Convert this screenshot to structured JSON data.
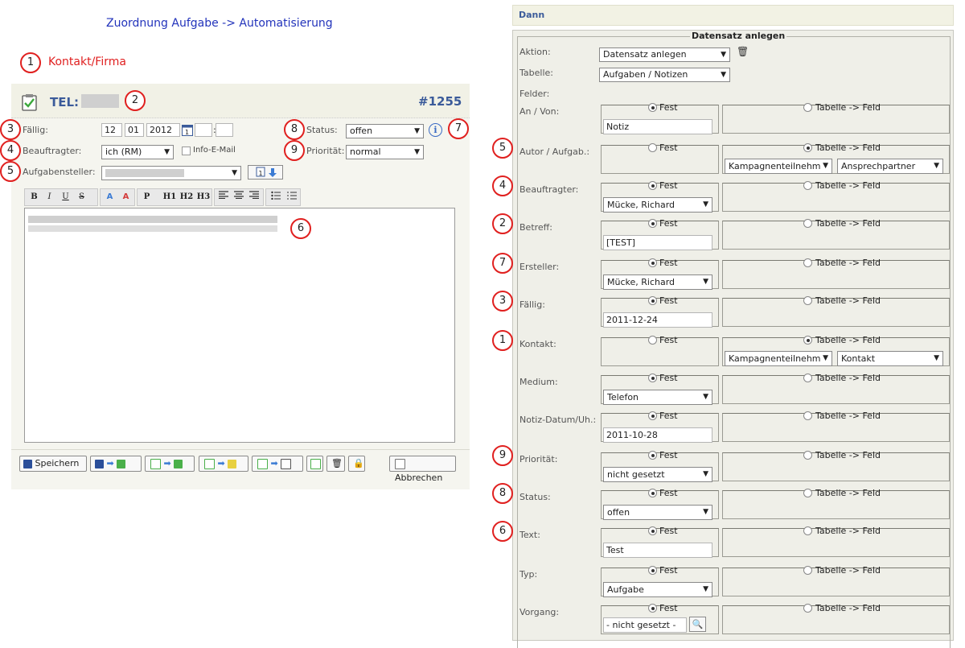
{
  "left": {
    "title": "Zuordnung Aufgabe -> Automatisierung",
    "link": "Kontakt/Firma",
    "task": {
      "heading": "TEL:",
      "number": "#1255",
      "due_label": "Fällig:",
      "due_day": "12",
      "due_month": "01",
      "due_year": "2012",
      "time_sep": ":",
      "assignee_label": "Beauftragter:",
      "assignee_value": "ich (RM)",
      "info_email": "Info-E-Mail",
      "creator_label": "Aufgabensteller:",
      "status_label": "Status:",
      "status_value": "offen",
      "priority_label": "Priorität:",
      "priority_value": "normal"
    },
    "toolbar": [
      "B",
      "I",
      "U",
      "S",
      "P",
      "H1",
      "H2",
      "H3"
    ],
    "buttons": {
      "save": "Speichern",
      "cancel": "Abbrechen"
    }
  },
  "right": {
    "header": "Dann",
    "legend": "Datensatz anlegen",
    "action_label": "Aktion:",
    "action_value": "Datensatz anlegen",
    "table_label": "Tabelle:",
    "table_value": "Aufgaben / Notizen",
    "fields_label": "Felder:",
    "opt_fixed": "Fest",
    "opt_table": "Tabelle -> Feld",
    "rows": [
      {
        "label": "An / Von:",
        "mode": "fixed",
        "kind": "input",
        "value": "Notiz"
      },
      {
        "label": "Autor / Aufgab.:",
        "mode": "table",
        "table": "Kampagnenteilnehm",
        "field": "Ansprechpartner"
      },
      {
        "label": "Beauftragter:",
        "mode": "fixed",
        "kind": "select",
        "value": "Mücke, Richard"
      },
      {
        "label": "Betreff:",
        "mode": "fixed",
        "kind": "input",
        "value": "[TEST]"
      },
      {
        "label": "Ersteller:",
        "mode": "fixed",
        "kind": "select",
        "value": "Mücke, Richard"
      },
      {
        "label": "Fällig:",
        "mode": "fixed",
        "kind": "input",
        "value": "2011-12-24"
      },
      {
        "label": "Kontakt:",
        "mode": "table",
        "table": "Kampagnenteilnehm",
        "field": "Kontakt"
      },
      {
        "label": "Medium:",
        "mode": "fixed",
        "kind": "select",
        "value": "Telefon"
      },
      {
        "label": "Notiz-Datum/Uh.:",
        "mode": "fixed",
        "kind": "input",
        "value": "2011-10-28"
      },
      {
        "label": "Priorität:",
        "mode": "fixed",
        "kind": "select",
        "value": "nicht gesetzt"
      },
      {
        "label": "Status:",
        "mode": "fixed",
        "kind": "select",
        "value": "offen"
      },
      {
        "label": "Text:",
        "mode": "fixed",
        "kind": "input",
        "value": "Test"
      },
      {
        "label": "Typ:",
        "mode": "fixed",
        "kind": "select",
        "value": "Aufgabe"
      },
      {
        "label": "Vorgang:",
        "mode": "fixed",
        "kind": "lookup",
        "value": "- nicht gesetzt -"
      }
    ]
  },
  "markers_left": [
    "1",
    "2",
    "3",
    "4",
    "5",
    "6",
    "7",
    "8",
    "9"
  ],
  "markers_right": [
    "5",
    "4",
    "2",
    "7",
    "3",
    "1",
    "9",
    "8",
    "6"
  ]
}
